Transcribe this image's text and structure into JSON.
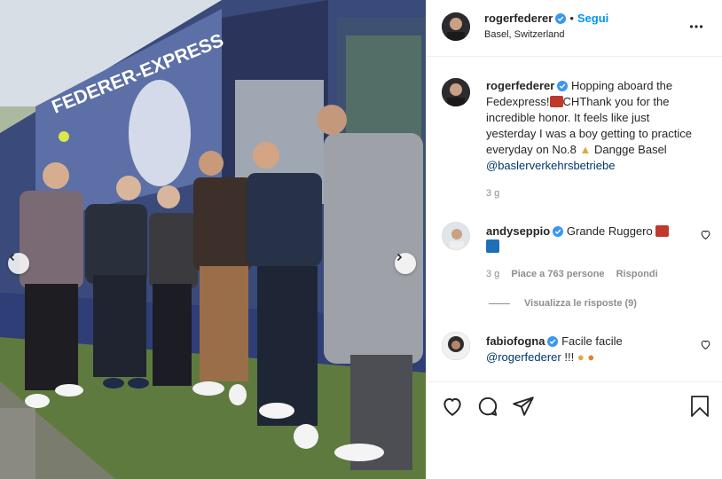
{
  "post": {
    "author": "rogerfederer",
    "follow_label": "Segui",
    "location": "Basel, Switzerland",
    "dot": "•"
  },
  "caption": {
    "author": "rogerfederer",
    "text_1": "Hopping aboard the",
    "text_2": "Fedexpress!",
    "text_2b": "CHThank you for the",
    "text_3": "incredible honor. It feels like just",
    "text_4": "yesterday I was a boy getting to practice",
    "text_5": "everyday on No.8",
    "text_5b": "Dangge Basel",
    "mention": "@baslerverkehrsbetriebe",
    "time": "3 g"
  },
  "comments": [
    {
      "author": "andyseppio",
      "text": "Grande Ruggero",
      "time": "3 g",
      "likes": "Piace a 763 persone",
      "reply": "Rispondi",
      "view_replies": "Visualizza le risposte (9)"
    },
    {
      "author": "fabiofogna",
      "text": "Facile facile",
      "mention": "@rogerfederer",
      "suffix": "!!!"
    }
  ],
  "photo": {
    "tram_text": "FEDERER-EXPRESS",
    "prev_icon": "chevron-left-icon",
    "next_icon": "chevron-right-icon"
  },
  "icons": {
    "like": "heart-icon",
    "comment": "comment-icon",
    "share": "share-icon",
    "save": "bookmark-icon",
    "more": "more-icon"
  },
  "colors": {
    "link": "#00376b",
    "follow": "#0095f6",
    "verified": "#3897f0",
    "muted": "#8e8e8e"
  }
}
